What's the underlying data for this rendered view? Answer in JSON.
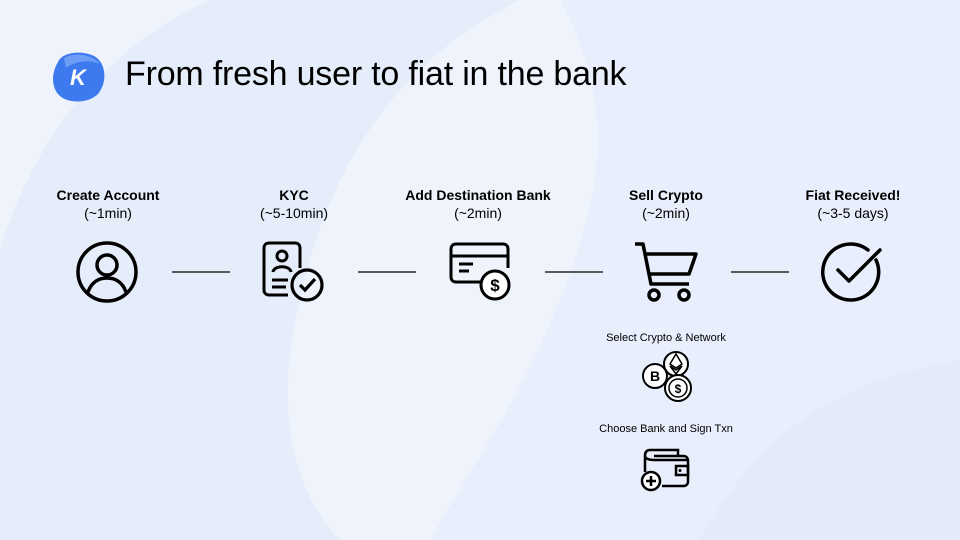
{
  "title": "From fresh user to fiat in the bank",
  "logo_letter": "K",
  "colors": {
    "background": "#eef3fc",
    "brand_blue": "#3d7af0",
    "brand_dark": "#2c5fd9",
    "ink": "#000000"
  },
  "steps": [
    {
      "label": "Create Account",
      "time": "(~1min)",
      "icon": "user-circle-icon"
    },
    {
      "label": "KYC",
      "time": "(~5-10min)",
      "icon": "id-document-check-icon"
    },
    {
      "label": "Add Destination Bank",
      "time": "(~2min)",
      "icon": "credit-card-dollar-icon"
    },
    {
      "label": "Sell Crypto",
      "time": "(~2min)",
      "icon": "shopping-cart-icon"
    },
    {
      "label": "Fiat Received!",
      "time": "(~3-5 days)",
      "icon": "check-circle-icon"
    }
  ],
  "sub_steps": [
    {
      "label": "Select Crypto & Network",
      "icon": "crypto-coins-icon"
    },
    {
      "label": "Choose Bank and Sign Txn",
      "icon": "wallet-add-icon"
    }
  ]
}
